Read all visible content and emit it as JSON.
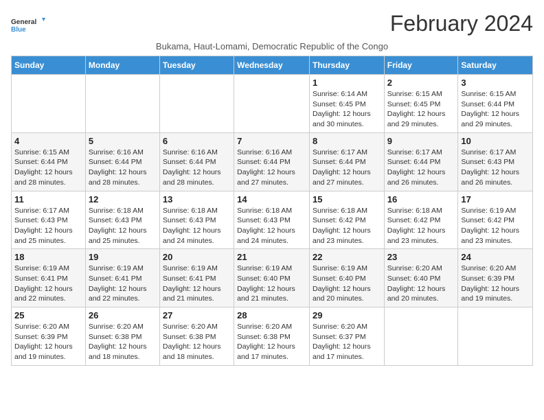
{
  "header": {
    "logo_line1": "General",
    "logo_line2": "Blue",
    "month_year": "February 2024",
    "subtitle": "Bukama, Haut-Lomami, Democratic Republic of the Congo"
  },
  "days_of_week": [
    "Sunday",
    "Monday",
    "Tuesday",
    "Wednesday",
    "Thursday",
    "Friday",
    "Saturday"
  ],
  "weeks": [
    [
      {
        "day": "",
        "info": ""
      },
      {
        "day": "",
        "info": ""
      },
      {
        "day": "",
        "info": ""
      },
      {
        "day": "",
        "info": ""
      },
      {
        "day": "1",
        "info": "Sunrise: 6:14 AM\nSunset: 6:45 PM\nDaylight: 12 hours\nand 30 minutes."
      },
      {
        "day": "2",
        "info": "Sunrise: 6:15 AM\nSunset: 6:45 PM\nDaylight: 12 hours\nand 29 minutes."
      },
      {
        "day": "3",
        "info": "Sunrise: 6:15 AM\nSunset: 6:44 PM\nDaylight: 12 hours\nand 29 minutes."
      }
    ],
    [
      {
        "day": "4",
        "info": "Sunrise: 6:15 AM\nSunset: 6:44 PM\nDaylight: 12 hours\nand 28 minutes."
      },
      {
        "day": "5",
        "info": "Sunrise: 6:16 AM\nSunset: 6:44 PM\nDaylight: 12 hours\nand 28 minutes."
      },
      {
        "day": "6",
        "info": "Sunrise: 6:16 AM\nSunset: 6:44 PM\nDaylight: 12 hours\nand 28 minutes."
      },
      {
        "day": "7",
        "info": "Sunrise: 6:16 AM\nSunset: 6:44 PM\nDaylight: 12 hours\nand 27 minutes."
      },
      {
        "day": "8",
        "info": "Sunrise: 6:17 AM\nSunset: 6:44 PM\nDaylight: 12 hours\nand 27 minutes."
      },
      {
        "day": "9",
        "info": "Sunrise: 6:17 AM\nSunset: 6:44 PM\nDaylight: 12 hours\nand 26 minutes."
      },
      {
        "day": "10",
        "info": "Sunrise: 6:17 AM\nSunset: 6:43 PM\nDaylight: 12 hours\nand 26 minutes."
      }
    ],
    [
      {
        "day": "11",
        "info": "Sunrise: 6:17 AM\nSunset: 6:43 PM\nDaylight: 12 hours\nand 25 minutes."
      },
      {
        "day": "12",
        "info": "Sunrise: 6:18 AM\nSunset: 6:43 PM\nDaylight: 12 hours\nand 25 minutes."
      },
      {
        "day": "13",
        "info": "Sunrise: 6:18 AM\nSunset: 6:43 PM\nDaylight: 12 hours\nand 24 minutes."
      },
      {
        "day": "14",
        "info": "Sunrise: 6:18 AM\nSunset: 6:43 PM\nDaylight: 12 hours\nand 24 minutes."
      },
      {
        "day": "15",
        "info": "Sunrise: 6:18 AM\nSunset: 6:42 PM\nDaylight: 12 hours\nand 23 minutes."
      },
      {
        "day": "16",
        "info": "Sunrise: 6:18 AM\nSunset: 6:42 PM\nDaylight: 12 hours\nand 23 minutes."
      },
      {
        "day": "17",
        "info": "Sunrise: 6:19 AM\nSunset: 6:42 PM\nDaylight: 12 hours\nand 23 minutes."
      }
    ],
    [
      {
        "day": "18",
        "info": "Sunrise: 6:19 AM\nSunset: 6:41 PM\nDaylight: 12 hours\nand 22 minutes."
      },
      {
        "day": "19",
        "info": "Sunrise: 6:19 AM\nSunset: 6:41 PM\nDaylight: 12 hours\nand 22 minutes."
      },
      {
        "day": "20",
        "info": "Sunrise: 6:19 AM\nSunset: 6:41 PM\nDaylight: 12 hours\nand 21 minutes."
      },
      {
        "day": "21",
        "info": "Sunrise: 6:19 AM\nSunset: 6:40 PM\nDaylight: 12 hours\nand 21 minutes."
      },
      {
        "day": "22",
        "info": "Sunrise: 6:19 AM\nSunset: 6:40 PM\nDaylight: 12 hours\nand 20 minutes."
      },
      {
        "day": "23",
        "info": "Sunrise: 6:20 AM\nSunset: 6:40 PM\nDaylight: 12 hours\nand 20 minutes."
      },
      {
        "day": "24",
        "info": "Sunrise: 6:20 AM\nSunset: 6:39 PM\nDaylight: 12 hours\nand 19 minutes."
      }
    ],
    [
      {
        "day": "25",
        "info": "Sunrise: 6:20 AM\nSunset: 6:39 PM\nDaylight: 12 hours\nand 19 minutes."
      },
      {
        "day": "26",
        "info": "Sunrise: 6:20 AM\nSunset: 6:38 PM\nDaylight: 12 hours\nand 18 minutes."
      },
      {
        "day": "27",
        "info": "Sunrise: 6:20 AM\nSunset: 6:38 PM\nDaylight: 12 hours\nand 18 minutes."
      },
      {
        "day": "28",
        "info": "Sunrise: 6:20 AM\nSunset: 6:38 PM\nDaylight: 12 hours\nand 17 minutes."
      },
      {
        "day": "29",
        "info": "Sunrise: 6:20 AM\nSunset: 6:37 PM\nDaylight: 12 hours\nand 17 minutes."
      },
      {
        "day": "",
        "info": ""
      },
      {
        "day": "",
        "info": ""
      }
    ]
  ]
}
